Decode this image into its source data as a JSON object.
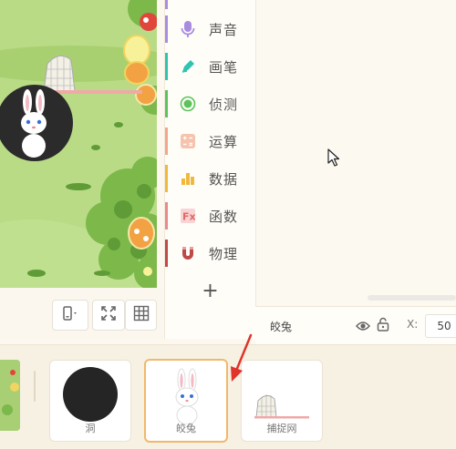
{
  "categories": [
    {
      "label": "声音",
      "icon": "microphone-icon",
      "color": "#a88ce0"
    },
    {
      "label": "画笔",
      "icon": "pen-icon",
      "color": "#2ec4b0"
    },
    {
      "label": "侦测",
      "icon": "detect-icon",
      "color": "#5cc35c"
    },
    {
      "label": "运算",
      "icon": "operator-icon",
      "color": "#f0a78a"
    },
    {
      "label": "数据",
      "icon": "data-icon",
      "color": "#f0b83c"
    },
    {
      "label": "函数",
      "icon": "function-icon",
      "color": "#e88a8a"
    },
    {
      "label": "物理",
      "icon": "magnet-icon",
      "color": "#c04848"
    }
  ],
  "add_category": "+",
  "sprite_info": {
    "name": "皎兔",
    "x_label": "X:",
    "x_value": "50"
  },
  "sprites": [
    {
      "name": "洞"
    },
    {
      "name": "皎兔",
      "selected": true
    },
    {
      "name": "捕捉网"
    }
  ],
  "colors": {
    "accent": "#f1b86b",
    "arrow": "#e0342a",
    "stage_green": "#b9db86"
  }
}
